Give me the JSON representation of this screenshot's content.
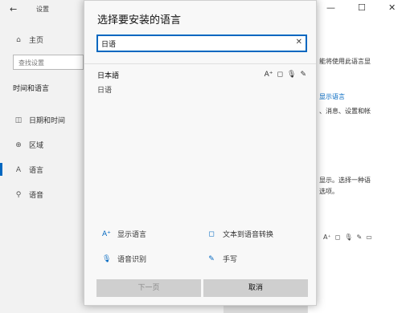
{
  "settings": {
    "title": "设置",
    "back": "←",
    "home": "主页",
    "search_placeholder": "查找设置",
    "section": "时间和语言",
    "items": [
      {
        "label": "日期和时间",
        "icon": "◫"
      },
      {
        "label": "区域",
        "icon": "⊕"
      },
      {
        "label": "语言",
        "icon": "A"
      },
      {
        "label": "语音",
        "icon": "⚲"
      }
    ],
    "win_controls": {
      "minimize": "—",
      "maximize": "☐",
      "close": "✕"
    },
    "right_texts": [
      "能将使用此语言显",
      "显示语言",
      "、消息、设置和帐",
      "显示。选择一种语",
      "选项。"
    ]
  },
  "dialog": {
    "title": "选择要安装的语言",
    "search_value": "日语",
    "clear": "✕",
    "result": {
      "native": "日本語",
      "local": "日语"
    },
    "result_icons": [
      "A⁺",
      "◻",
      "🎙",
      "✎"
    ],
    "features": [
      {
        "label": "显示语言",
        "icon": "A⁺"
      },
      {
        "label": "文本到语音转换",
        "icon": "◻"
      },
      {
        "label": "语音识别",
        "icon": "🎙"
      },
      {
        "label": "手写",
        "icon": "✎"
      }
    ],
    "btn_next": "下一页",
    "btn_cancel": "取消"
  },
  "colors": {
    "accent": "#0067c0"
  }
}
